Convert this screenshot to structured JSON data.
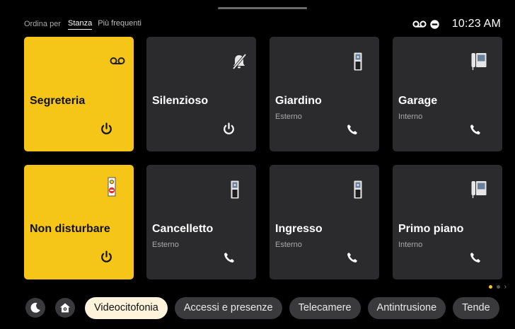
{
  "sort": {
    "label": "Ordina per",
    "options": [
      "Stanza",
      "Più frequenti"
    ],
    "selected": "Stanza"
  },
  "status": {
    "icons": [
      "voicemail-icon",
      "do-not-disturb-icon"
    ],
    "time": "10:23 AM"
  },
  "tiles": [
    {
      "title": "Segreteria",
      "subtitle": "",
      "color": "#f5c518",
      "icon": "voicemail-icon",
      "action": "power-icon"
    },
    {
      "title": "Silenzioso",
      "subtitle": "",
      "color": "#2b2b2d",
      "icon": "bell-off-icon",
      "action": "power-icon"
    },
    {
      "title": "Giardino",
      "subtitle": "Esterno",
      "color": "#2b2b2d",
      "icon": "outdoor-panel-icon",
      "action": "phone-icon"
    },
    {
      "title": "Garage",
      "subtitle": "Interno",
      "color": "#2b2b2d",
      "icon": "intercom-icon",
      "action": "phone-icon"
    },
    {
      "title": "Non disturbare",
      "subtitle": "",
      "color": "#f5c518",
      "icon": "door-hanger-icon",
      "action": "power-icon"
    },
    {
      "title": "Cancelletto",
      "subtitle": "Esterno",
      "color": "#2b2b2d",
      "icon": "outdoor-panel-icon",
      "action": "phone-icon"
    },
    {
      "title": "Ingresso",
      "subtitle": "Esterno",
      "color": "#2b2b2d",
      "icon": "outdoor-panel-icon",
      "action": "phone-icon"
    },
    {
      "title": "Primo piano",
      "subtitle": "Interno",
      "color": "#2b2b2d",
      "icon": "intercom-icon",
      "action": "phone-icon"
    }
  ],
  "pagination": {
    "pages": 2,
    "current": 1
  },
  "bottom": {
    "buttons": [
      "moon-icon",
      "home-settings-icon"
    ],
    "categories": [
      "Videocitofonia",
      "Accessi e presenze",
      "Telecamere",
      "Antintrusione",
      "Tende"
    ],
    "selected": "Videocitofonia"
  },
  "colors": {
    "accent": "#f5c518",
    "tile": "#2b2b2d",
    "chip": "#3a3a3c",
    "chip_active": "#fff3dc"
  }
}
